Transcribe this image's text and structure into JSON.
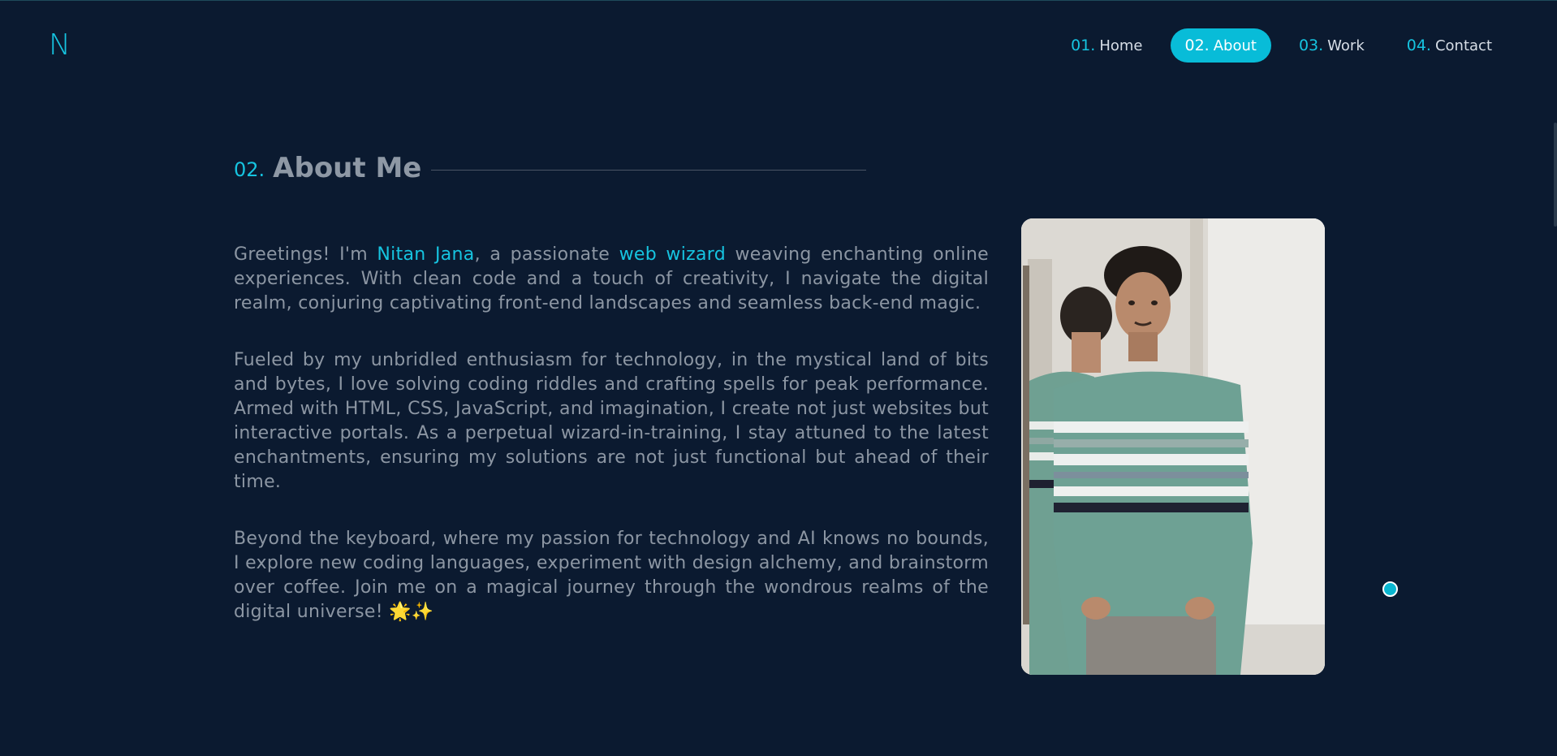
{
  "header": {
    "logo": "N",
    "nav": [
      {
        "num": "01.",
        "label": "Home"
      },
      {
        "num": "02.",
        "label": "About"
      },
      {
        "num": "03.",
        "label": "Work"
      },
      {
        "num": "04.",
        "label": "Contact"
      }
    ]
  },
  "about": {
    "section_num": "02.",
    "section_title": "About Me",
    "p1": {
      "a": "Greetings! I'm ",
      "name": "Nitan Jana",
      "b": ", a passionate ",
      "role": "web wizard",
      "c": " weaving enchanting online experiences. With clean code and a touch of creativity, I navigate the digital realm, conjuring captivating front-end landscapes and seamless back-end magic."
    },
    "p2": "Fueled by my unbridled enthusiasm for technology, in the mystical land of bits and bytes, I love solving coding riddles and crafting spells for peak performance. Armed with HTML, CSS, JavaScript, and imagination, I create not just websites but interactive portals. As a perpetual wizard-in-training, I stay attuned to the latest enchantments, ensuring my solutions are not just functional but ahead of their time.",
    "p3": "Beyond the keyboard, where my passion for technology and AI knows no bounds, I explore new coding languages, experiment with design alchemy, and brainstorm over coffee. Join me on a magical journey through the wondrous realms of the digital universe! 🌟✨"
  },
  "colors": {
    "background": "#0b1a30",
    "accent": "#16c4e0",
    "text": "#8c96a3"
  }
}
